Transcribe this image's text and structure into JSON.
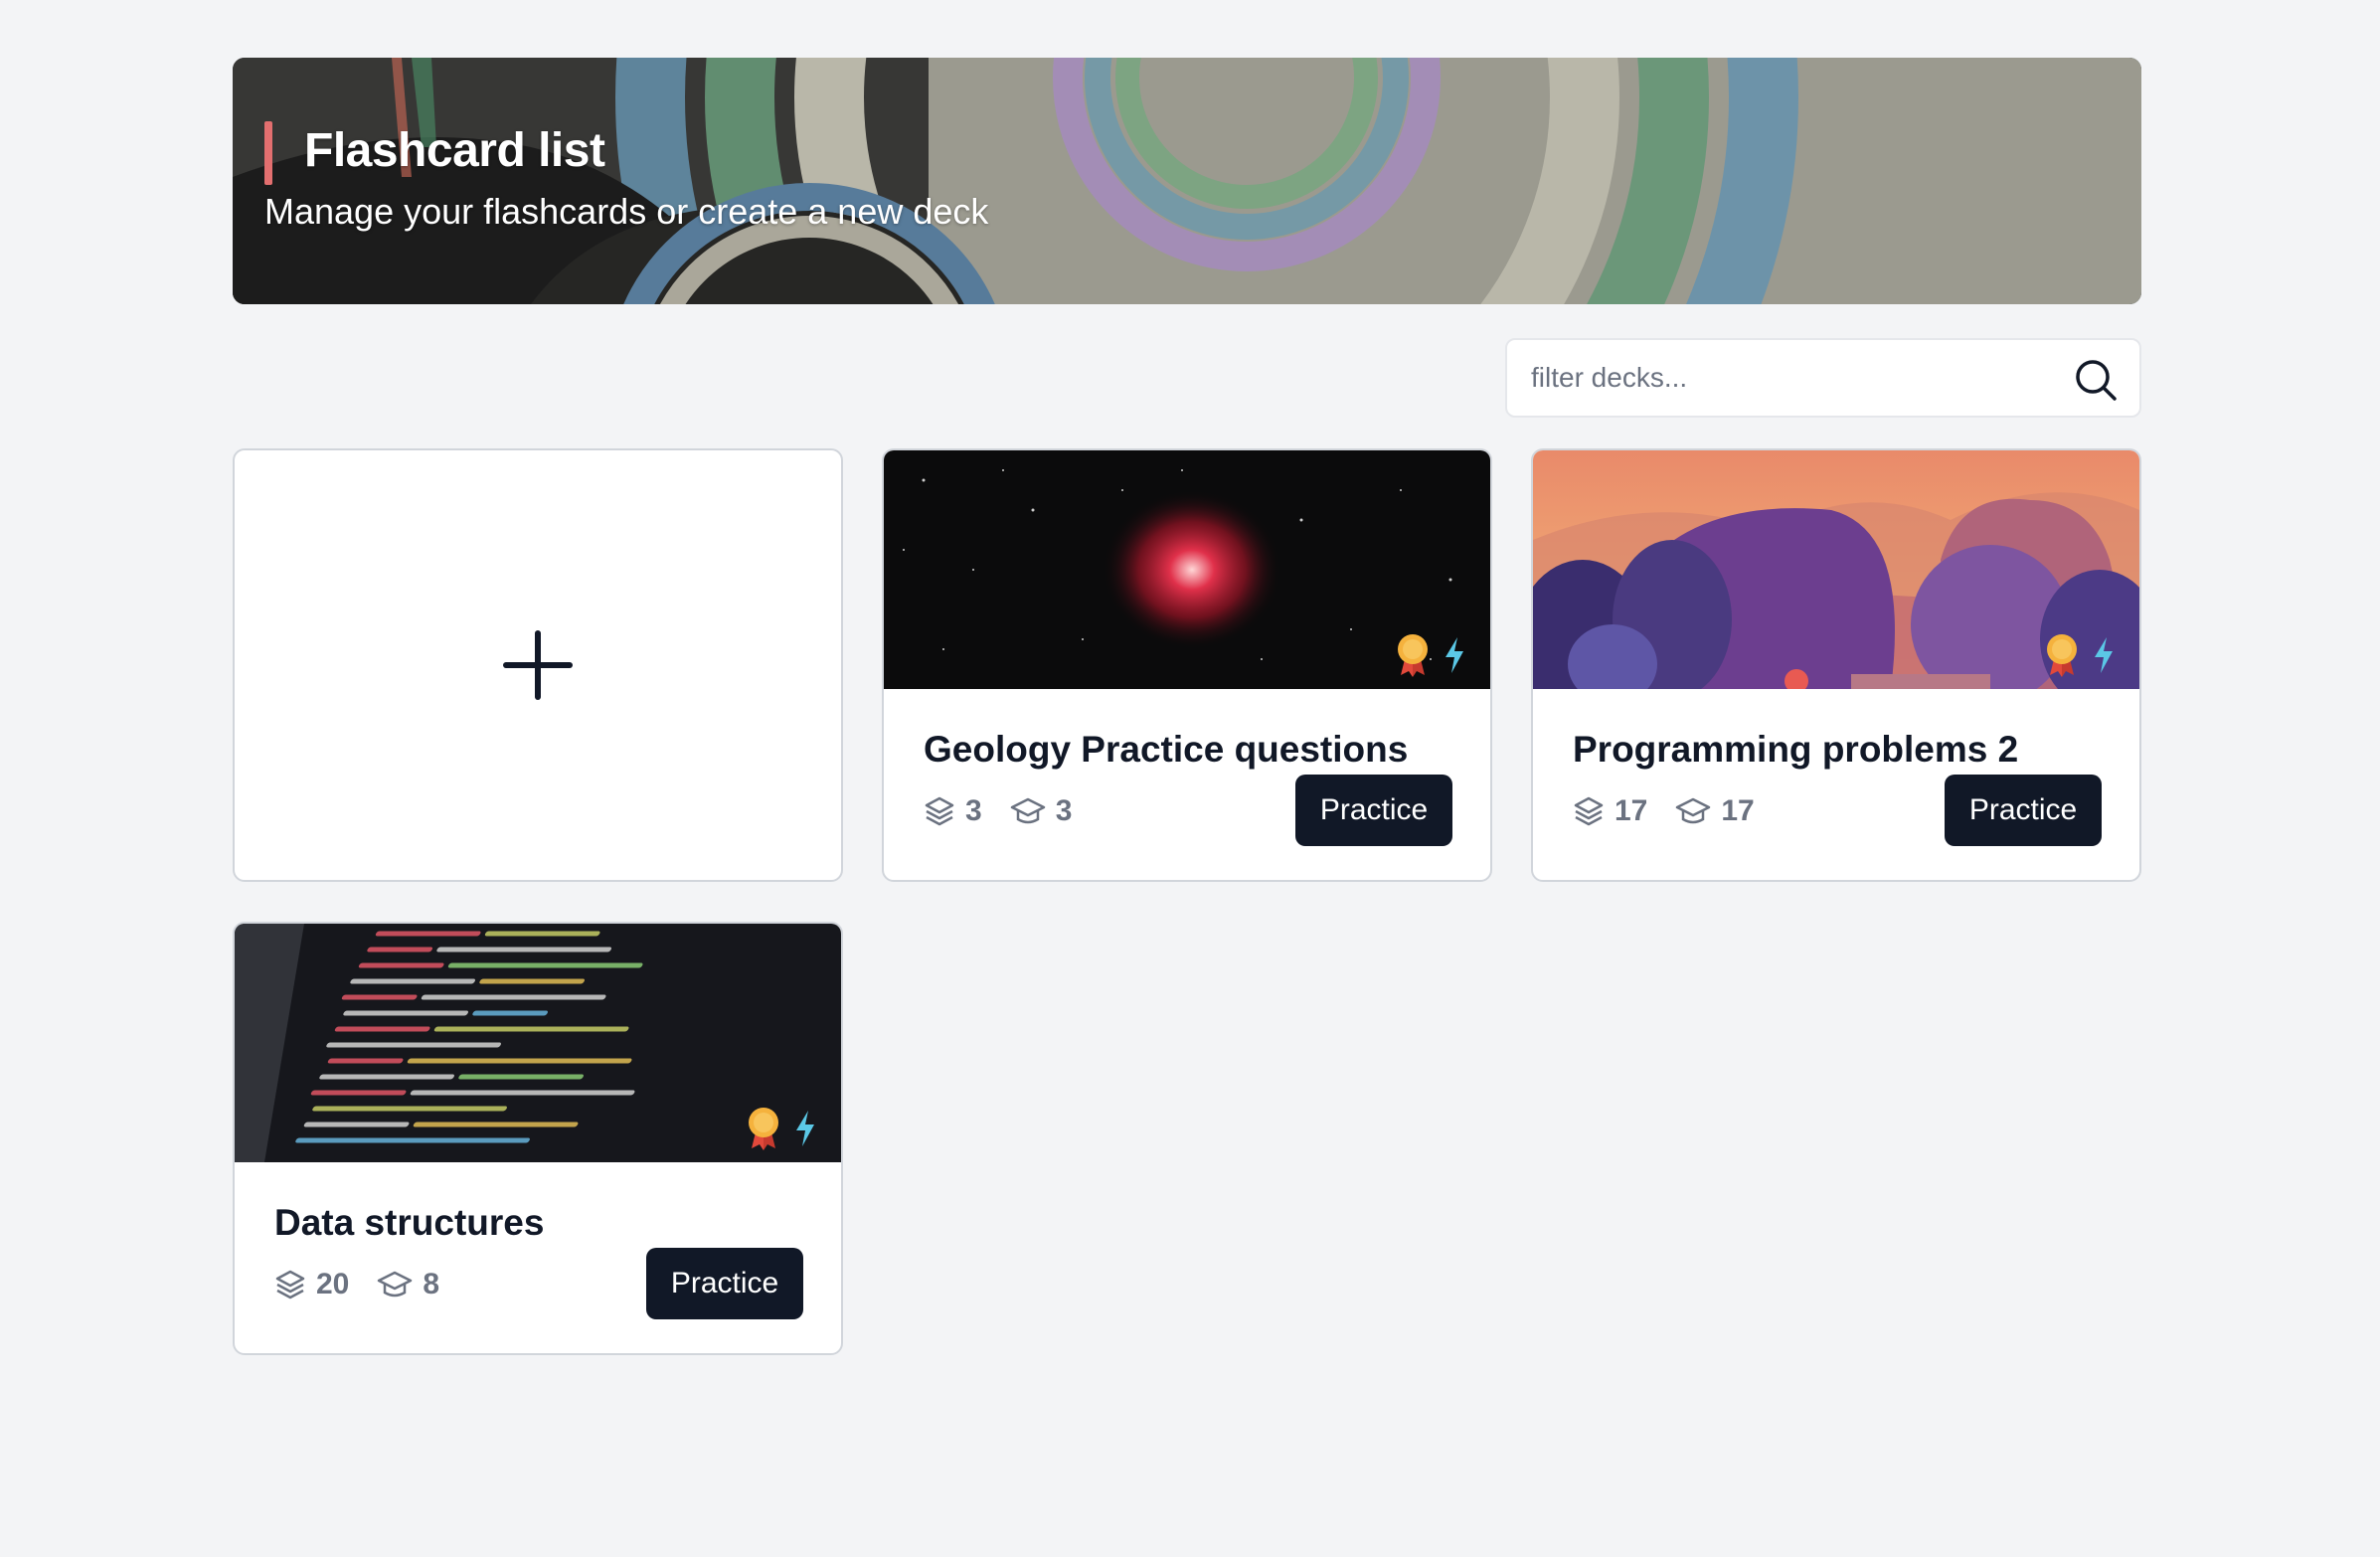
{
  "header": {
    "title": "Flashcard list",
    "subtitle": "Manage your flashcards or create a new deck"
  },
  "search": {
    "placeholder": "filter decks...",
    "value": ""
  },
  "new_deck": {
    "icon": "plus-icon"
  },
  "decks": [
    {
      "title": "Geology Practice questions",
      "cards": "3",
      "learned": "3",
      "button": "Practice",
      "image": "nebula-space-photo"
    },
    {
      "title": "Programming problems 2",
      "cards": "17",
      "learned": "17",
      "button": "Practice",
      "image": "sunset-landscape-illustration"
    },
    {
      "title": "Data structures",
      "cards": "20",
      "learned": "8",
      "button": "Practice",
      "image": "code-screen-photo"
    }
  ],
  "colors": {
    "accent": "#e36f6f",
    "button_bg": "#111827",
    "page_bg": "#f3f4f6",
    "badge_medal": "#f5b23d",
    "badge_bolt": "#5bc8e6"
  },
  "icons": [
    "search-icon",
    "plus-icon",
    "layers-icon",
    "graduation-cap-icon",
    "medal-icon",
    "bolt-icon"
  ]
}
